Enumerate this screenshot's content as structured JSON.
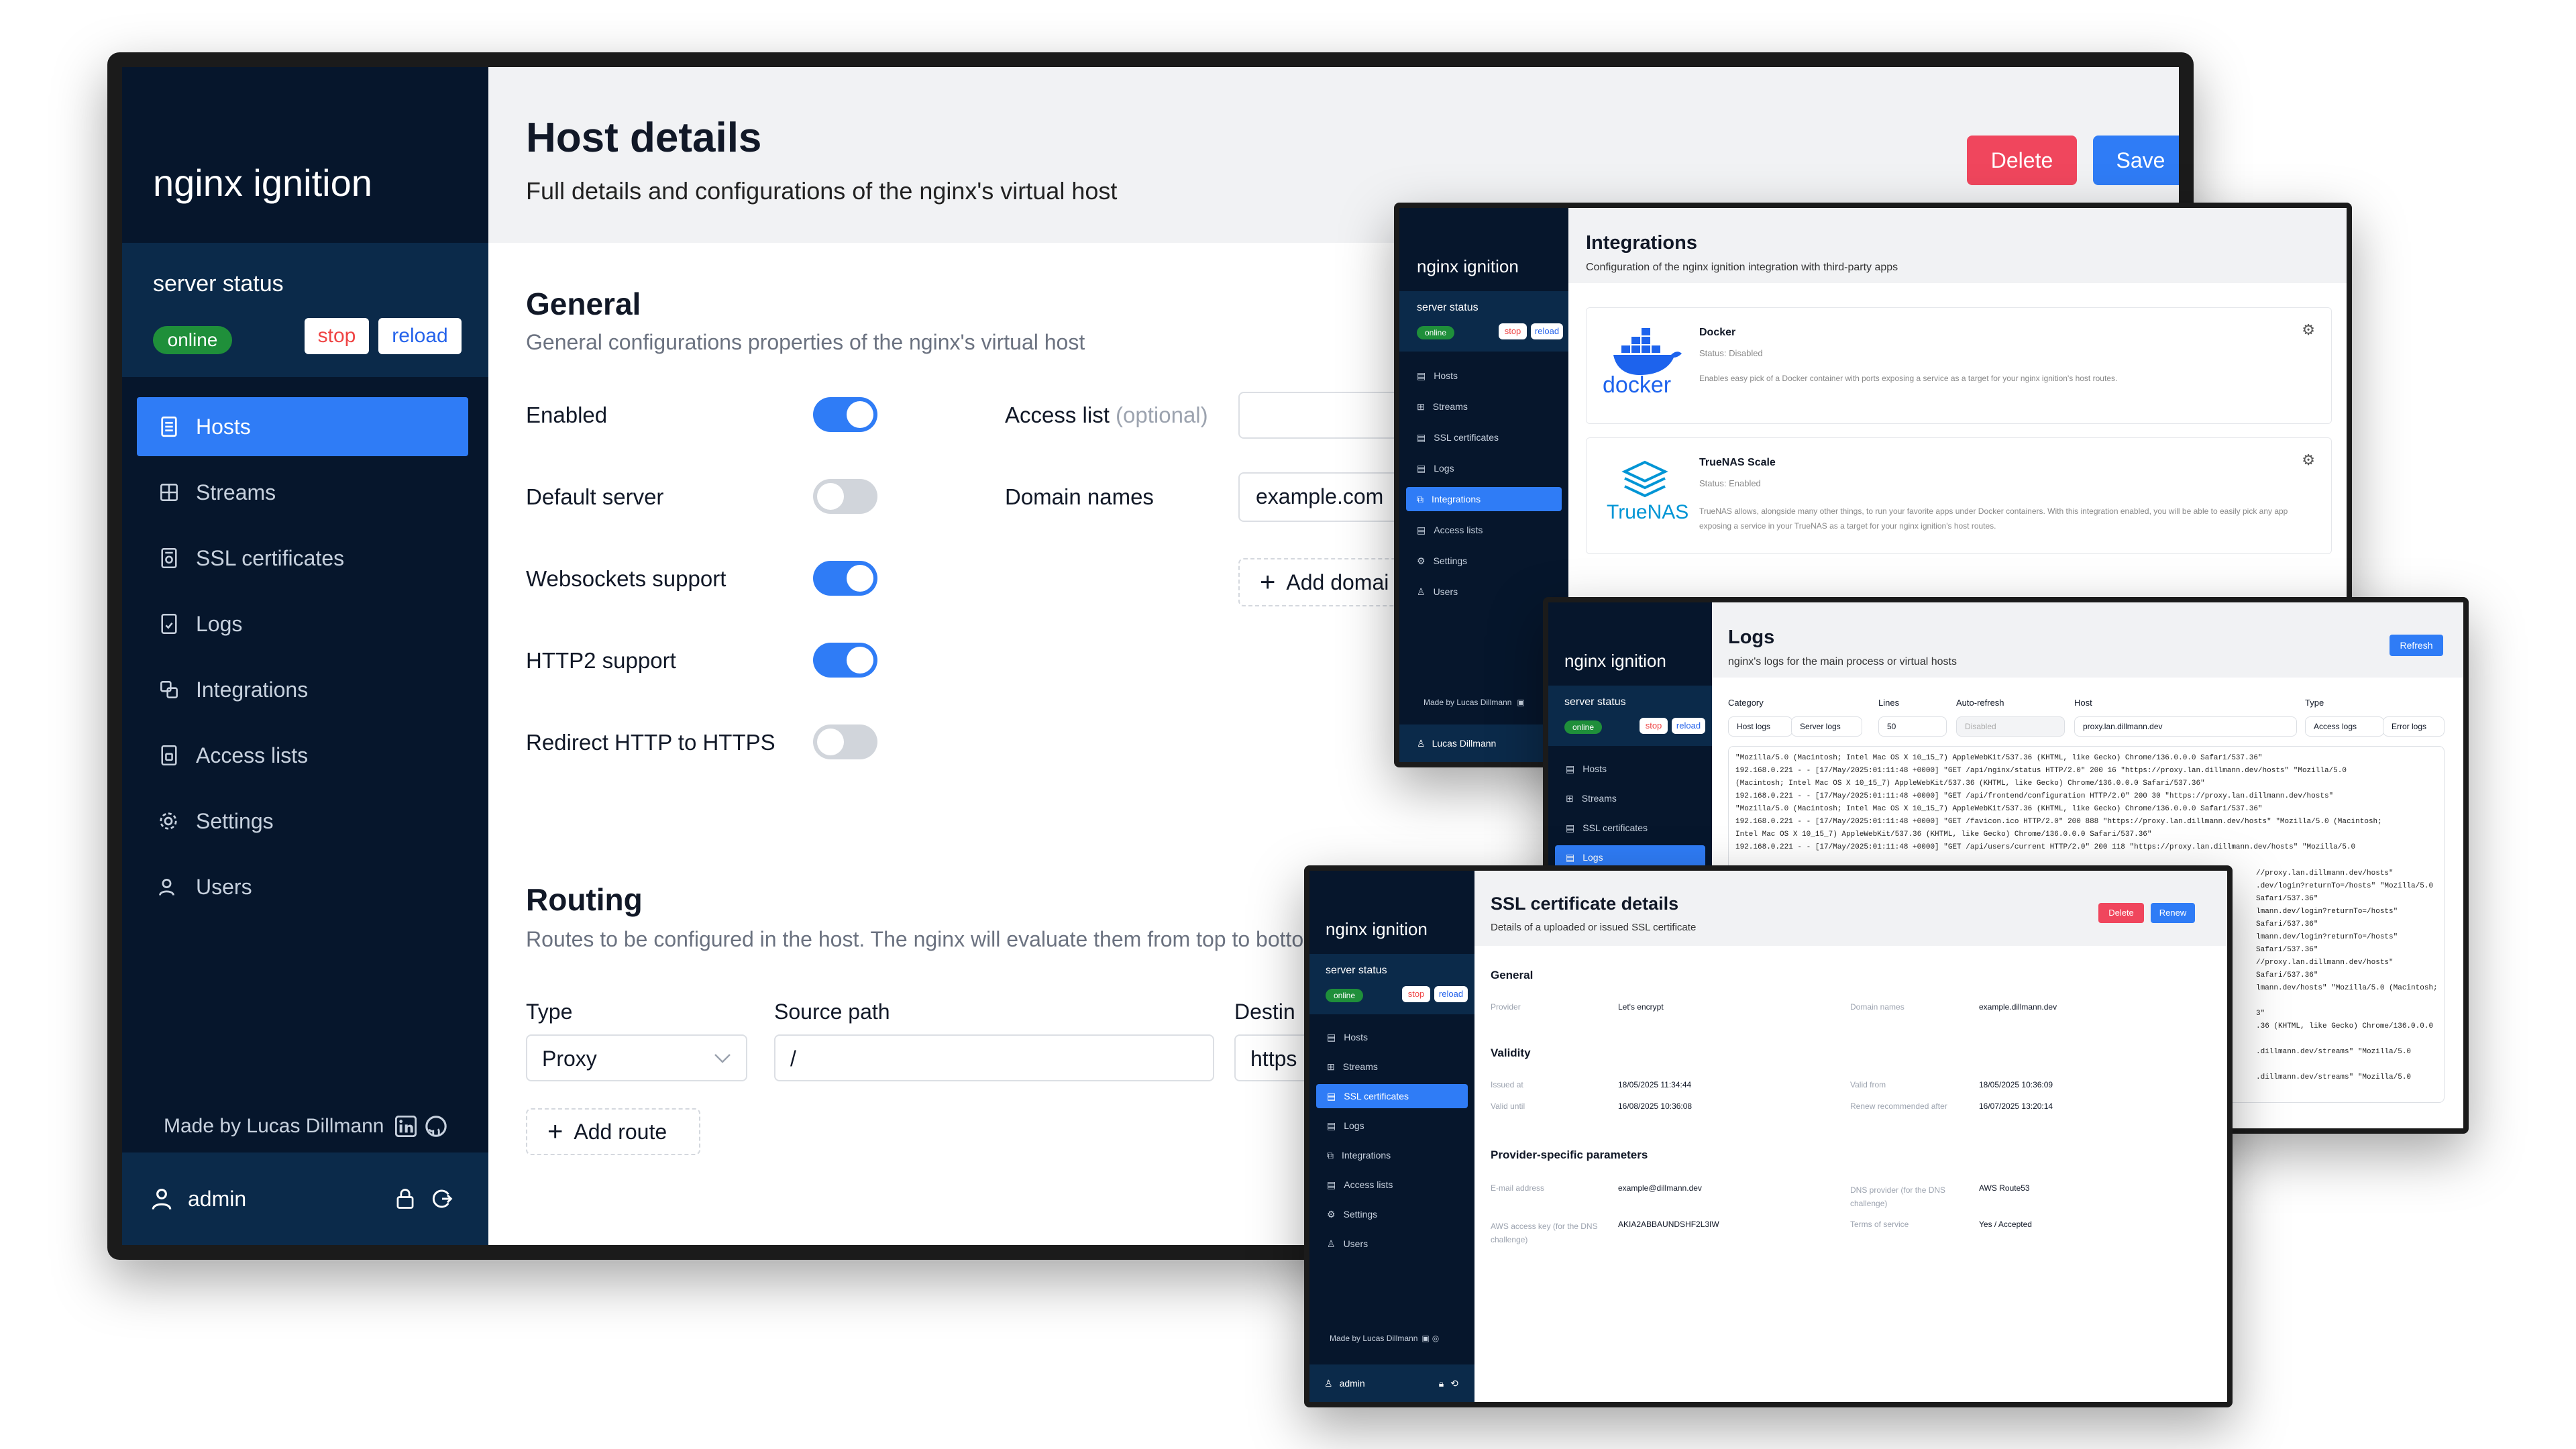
{
  "app": {
    "name": "nginx ignition"
  },
  "server_status": {
    "label": "server status",
    "state": "online",
    "stop": "stop",
    "reload": "reload"
  },
  "menu": [
    "Hosts",
    "Streams",
    "SSL certificates",
    "Logs",
    "Integrations",
    "Access lists",
    "Settings",
    "Users"
  ],
  "footer": {
    "made_by": "Made by Lucas Dillmann",
    "user": "admin",
    "user_alt": "Lucas Dillmann"
  },
  "host_details": {
    "title": "Host details",
    "subtitle": "Full details and configurations of the nginx's virtual host",
    "delete": "Delete",
    "save": "Save",
    "general": {
      "title": "General",
      "subtitle": "General configurations properties of the nginx's virtual host",
      "toggles": [
        {
          "label": "Enabled",
          "on": true
        },
        {
          "label": "Default server",
          "on": false
        },
        {
          "label": "Websockets support",
          "on": true
        },
        {
          "label": "HTTP2 support",
          "on": true
        },
        {
          "label": "Redirect HTTP to HTTPS",
          "on": false
        }
      ],
      "access_list_label": "Access list",
      "access_list_optional": "(optional)",
      "domain_names_label": "Domain names",
      "domain_value": "example.com",
      "add_domain": "Add domai"
    },
    "routing": {
      "title": "Routing",
      "subtitle": "Routes to be configured in the host. The nginx will evaluate them from top to botto",
      "type_label": "Type",
      "type_value": "Proxy",
      "source_label": "Source path",
      "source_value": "/",
      "dest_label": "Destin",
      "dest_value": "https",
      "add_route": "Add route"
    }
  },
  "integrations": {
    "title": "Integrations",
    "subtitle": "Configuration of the nginx ignition integration with third-party apps",
    "items": [
      {
        "name": "Docker",
        "logo": "docker",
        "status": "Status: Disabled",
        "description": "Enables easy pick of a Docker container with ports exposing a service as a target for your nginx ignition's host routes."
      },
      {
        "name": "TrueNAS Scale",
        "logo": "TrueNAS",
        "status": "Status: Enabled",
        "description": "TrueNAS allows, alongside many other things, to run your favorite apps under Docker containers. With this integration enabled, you will be able to easily pick any app exposing a service in your TrueNAS as a target for your nginx ignition's host routes."
      }
    ]
  },
  "logs": {
    "title": "Logs",
    "subtitle": "nginx's logs for the main process or virtual hosts",
    "refresh": "Refresh",
    "filters": {
      "category_label": "Category",
      "host_logs": "Host logs",
      "server_logs": "Server logs",
      "lines_label": "Lines",
      "lines_value": "50",
      "auto_refresh_label": "Auto-refresh",
      "auto_refresh_value": "Disabled",
      "host_label": "Host",
      "host_value": "proxy.lan.dillmann.dev",
      "type_label": "Type",
      "access_logs": "Access logs",
      "error_logs": "Error logs"
    },
    "lines": [
      "\"Mozilla/5.0 (Macintosh; Intel Mac OS X 10_15_7) AppleWebKit/537.36 (KHTML, like Gecko) Chrome/136.0.0.0 Safari/537.36\"",
      "192.168.0.221 - - [17/May/2025:01:11:48 +0000] \"GET /api/nginx/status HTTP/2.0\" 200 16 \"https://proxy.lan.dillmann.dev/hosts\" \"Mozilla/5.0",
      "(Macintosh; Intel Mac OS X 10_15_7) AppleWebKit/537.36 (KHTML, like Gecko) Chrome/136.0.0.0 Safari/537.36\"",
      "192.168.0.221 - - [17/May/2025:01:11:48 +0000] \"GET /api/frontend/configuration HTTP/2.0\" 200 30 \"https://proxy.lan.dillmann.dev/hosts\"",
      "\"Mozilla/5.0 (Macintosh; Intel Mac OS X 10_15_7) AppleWebKit/537.36 (KHTML, like Gecko) Chrome/136.0.0.0 Safari/537.36\"",
      "192.168.0.221 - - [17/May/2025:01:11:48 +0000] \"GET /favicon.ico HTTP/2.0\" 200 888 \"https://proxy.lan.dillmann.dev/hosts\" \"Mozilla/5.0 (Macintosh;",
      "Intel Mac OS X 10_15_7) AppleWebKit/537.36 (KHTML, like Gecko) Chrome/136.0.0.0 Safari/537.36\"",
      "192.168.0.221 - - [17/May/2025:01:11:48 +0000] \"GET /api/users/current HTTP/2.0\" 200 118 \"https://proxy.lan.dillmann.dev/hosts\" \"Mozilla/5.0"
    ],
    "lines_right": [
      "//proxy.lan.dillmann.dev/hosts\"",
      ".dev/login?returnTo=/hosts\" \"Mozilla/5.0",
      "Safari/537.36\"",
      "lmann.dev/login?returnTo=/hosts\"",
      "Safari/537.36\"",
      "lmann.dev/login?returnTo=/hosts\"",
      "Safari/537.36\"",
      "//proxy.lan.dillmann.dev/hosts\"",
      "Safari/537.36\"",
      "lmann.dev/hosts\" \"Mozilla/5.0 (Macintosh;",
      "",
      "3\"",
      ".36 (KHTML, like Gecko) Chrome/136.0.0.0",
      "",
      ".dillmann.dev/streams\" \"Mozilla/5.0",
      "",
      ".dillmann.dev/streams\" \"Mozilla/5.0"
    ]
  },
  "ssl": {
    "title": "SSL certificate details",
    "subtitle": "Details of a uploaded or issued SSL certificate",
    "delete": "Delete",
    "renew": "Renew",
    "general_title": "General",
    "provider_label": "Provider",
    "provider_value": "Let's encrypt",
    "domains_label": "Domain names",
    "domains_value": "example.dillmann.dev",
    "validity_title": "Validity",
    "issued_label": "Issued at",
    "issued_value": "18/05/2025 11:34:44",
    "valid_from_label": "Valid from",
    "valid_from_value": "18/05/2025 10:36:09",
    "valid_until_label": "Valid until",
    "valid_until_value": "16/08/2025 10:36:08",
    "renew_after_label": "Renew recommended after",
    "renew_after_value": "16/07/2025 13:20:14",
    "provider_params_title": "Provider-specific parameters",
    "email_label": "E-mail address",
    "email_value": "example@dillmann.dev",
    "dns_label": "DNS provider (for the DNS challenge)",
    "dns_value": "AWS Route53",
    "aws_label": "AWS access key (for the DNS challenge)",
    "aws_value": "AKIA2ABBAUNDSHF2L3IW",
    "terms_label": "Terms of service",
    "terms_value": "Yes / Accepted"
  }
}
